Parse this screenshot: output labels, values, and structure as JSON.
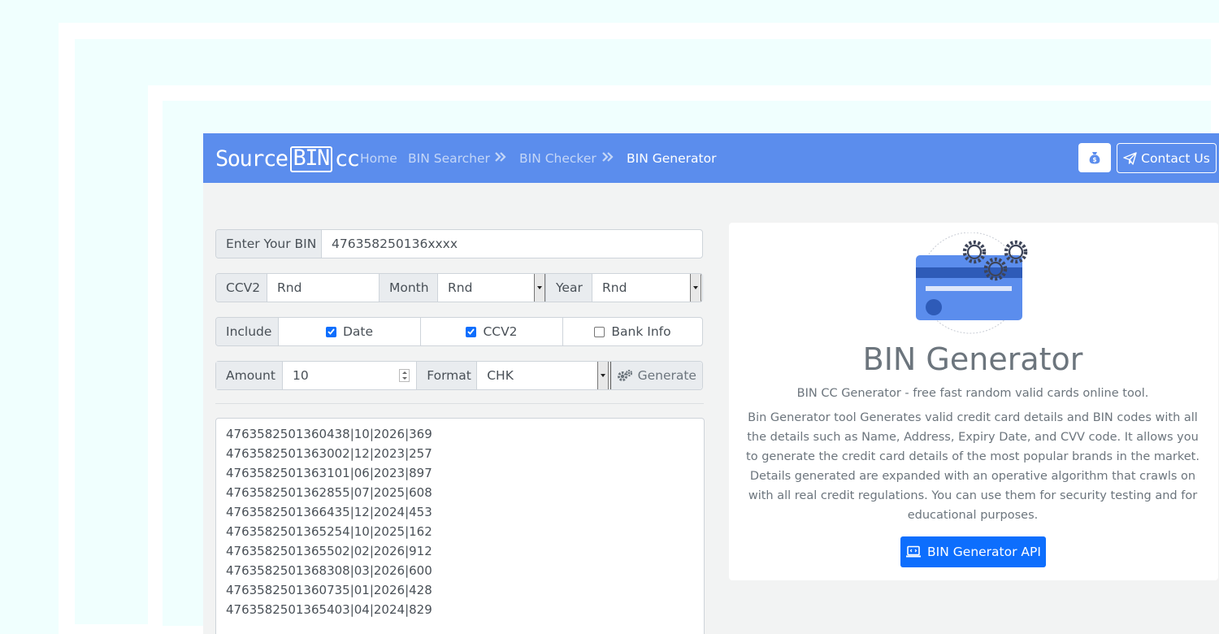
{
  "brand": {
    "part1": "Source",
    "part2": "BIN",
    "part3": "cc"
  },
  "nav": {
    "home": "Home",
    "searcher": "BIN Searcher",
    "checker": "BIN Checker",
    "generator": "BIN Generator",
    "contact": "Contact Us",
    "donate_icon": "money-bag-icon",
    "contact_icon": "paper-plane-icon"
  },
  "form": {
    "bin_label": "Enter Your BIN",
    "bin_value": "476358250136xxxx",
    "ccv2_label": "CCV2",
    "ccv2_value": "Rnd",
    "month_label": "Month",
    "month_value": "Rnd",
    "year_label": "Year",
    "year_value": "Rnd",
    "include_label": "Include",
    "include_date": "Date",
    "include_date_checked": true,
    "include_ccv2": "CCV2",
    "include_ccv2_checked": true,
    "include_bank": "Bank Info",
    "include_bank_checked": false,
    "amount_label": "Amount",
    "amount_value": "10",
    "format_label": "Format",
    "format_value": "CHK",
    "generate_label": "Generate"
  },
  "results": [
    "4763582501360438|10|2026|369",
    "4763582501363002|12|2023|257",
    "4763582501363101|06|2023|897",
    "4763582501362855|07|2025|608",
    "4763582501366435|12|2024|453",
    "4763582501365254|10|2025|162",
    "4763582501365502|02|2026|912",
    "4763582501368308|03|2026|600",
    "4763582501360735|01|2026|428",
    "4763582501365403|04|2024|829"
  ],
  "info": {
    "title": "BIN Generator",
    "subtitle": "BIN CC Generator - free fast random valid cards online tool.",
    "description": "Bin Generator tool Generates valid credit card details and BIN codes with all the details such as Name, Address, Expiry Date, and CVV code. It allows you to generate the credit card details of the most popular brands in the market. Details generated are expanded with an operative algorithm that crawls on with all real credit regulations. You can use them for security testing and for educational purposes.",
    "api_button": "BIN Generator API"
  },
  "colors": {
    "navbar": "#5b8ded",
    "primary": "#0d6efd",
    "page_bg": "#f2f3f3",
    "outer_bg": "#f0fffe"
  }
}
